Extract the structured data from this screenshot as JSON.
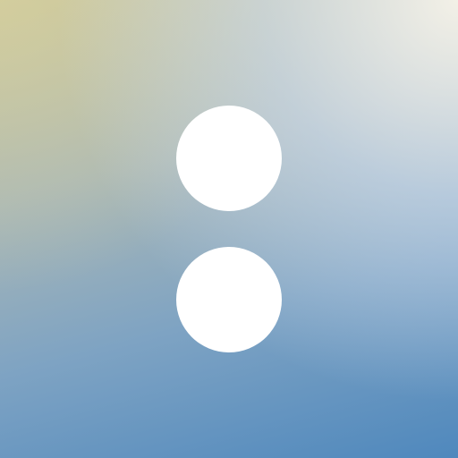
{
  "icon": {
    "name": "colon-icon",
    "dot_color": "#ffffff",
    "gradient": {
      "top_left": "#d6d3a6",
      "top_right": "#f1f0e8",
      "middle": "#9fb3c6",
      "bottom": "#4f88bd"
    }
  }
}
